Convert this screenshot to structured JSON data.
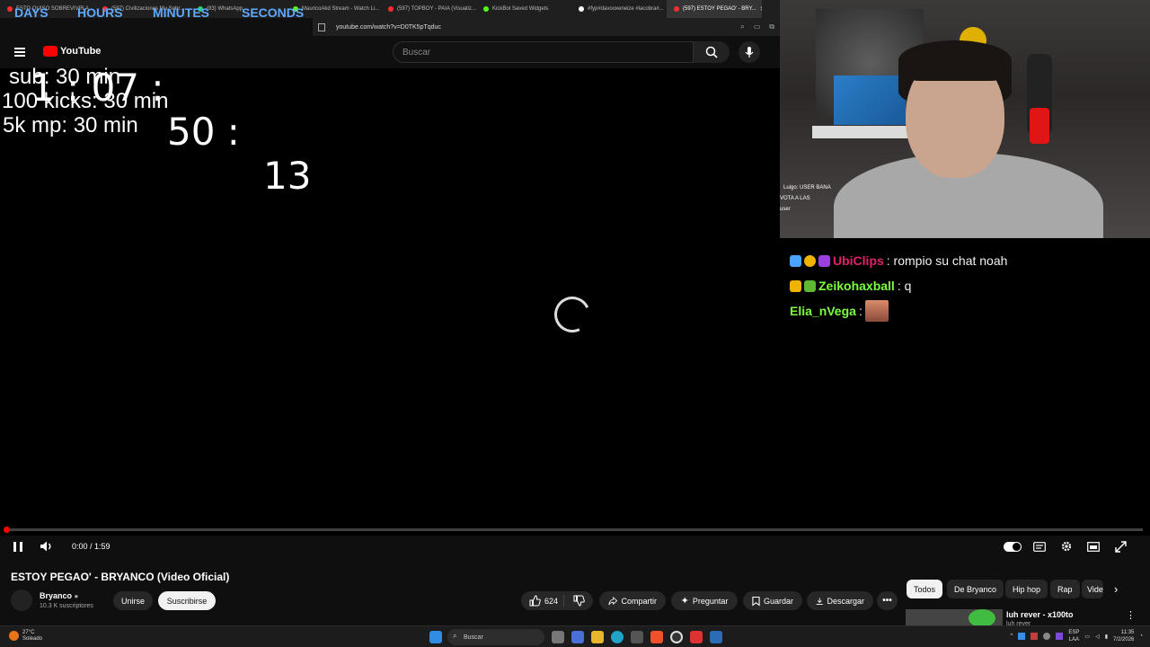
{
  "browser": {
    "tabs": [
      {
        "title": "ESTO QUISO SOBREVIVIR A...",
        "favicon_color": "#ff2d2d"
      },
      {
        "title": "(597) Civilizaciones Mu Sobr...",
        "favicon_color": "#ff2d2d"
      },
      {
        "title": "(83) WhatsApp",
        "favicon_color": "#25d366"
      },
      {
        "title": "MauricoAkd Stream - Watch Li...",
        "favicon_color": "#53fc18"
      },
      {
        "title": "(597) TOPBOY - PAIA (Visualiz...",
        "favicon_color": "#ff2d2d"
      },
      {
        "title": "KickBot Saved Widgets",
        "favicon_color": "#53fc18"
      },
      {
        "title": "#fyp#davooxeneize #lacobra#...",
        "favicon_color": "#ffffff"
      },
      {
        "title": "(597) ESTOY PEGAO' - BRY...",
        "favicon_color": "#ff2d2d",
        "active": true
      }
    ],
    "url": "youtube.com/watch?v=D0TK5pTqduc"
  },
  "youtube": {
    "logo_text": "YouTube",
    "search_placeholder": "Buscar"
  },
  "countdown": {
    "labels": {
      "days": "DAYS",
      "hours": "HOURS",
      "minutes": "MINUTES",
      "seconds": "SECONDS"
    },
    "values": {
      "days_hours": "1 : 07 :",
      "minutes": "50 :",
      "seconds": "13"
    }
  },
  "goals": [
    "sub: 30 min",
    "100 kicks: 30 min",
    "5k mp: 30 min"
  ],
  "webcam_mini_chat": [
    "Luigo: USER BANA",
    "VOTA A LAS",
    "user"
  ],
  "chat": [
    {
      "user": "UbiClips",
      "user_color": "#e0216b",
      "message": ": rompio su chat noah"
    },
    {
      "user": "Zeikohaxball",
      "user_color": "#7cff3a",
      "message": ": q"
    },
    {
      "user": "Elia_nVega",
      "user_color": "#7cff3a",
      "message": ":"
    }
  ],
  "player": {
    "time": "0:00 / 1:59",
    "progress": 0
  },
  "video": {
    "title": "ESTOY PEGAO' - BRYANCO (Video Oficial)",
    "channel": "Bryanco",
    "subscribers": "10.3 K suscriptores",
    "join_label": "Unirse",
    "subscribe_label": "Suscribirse",
    "likes": "624",
    "share_label": "Compartir",
    "ask_label": "Preguntar",
    "save_label": "Guardar",
    "download_label": "Descargar"
  },
  "chips": [
    "Todos",
    "De Bryanco",
    "Hip hop",
    "Rap",
    "Vide"
  ],
  "recommendation": {
    "title": "luh rever - x100to",
    "channel": "luh rever"
  },
  "taskbar": {
    "weather_temp": "27°C",
    "weather_desc": "Soleado",
    "search_label": "Buscar",
    "lang": "ESP",
    "lang_sub": "LAA",
    "time": "11:35",
    "date": "7/2/2026"
  }
}
